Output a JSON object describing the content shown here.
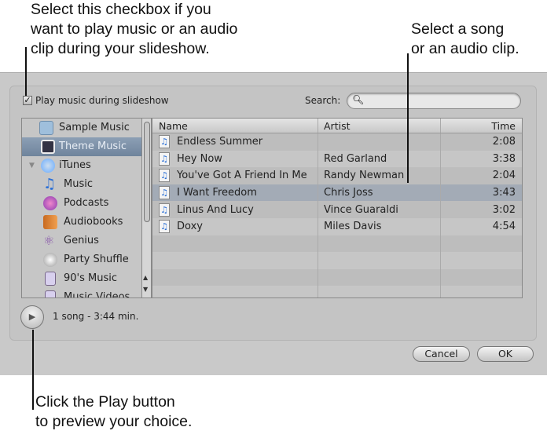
{
  "callouts": {
    "checkbox": [
      "Select this checkbox if you",
      "want to play music or an audio",
      "clip during your slideshow."
    ],
    "song": [
      "Select a song",
      "or an audio clip."
    ],
    "play": [
      "Click the Play button",
      "to preview your choice."
    ]
  },
  "options": {
    "play_music_label": "Play music during slideshow",
    "play_music_checked": true
  },
  "search": {
    "label": "Search:",
    "value": ""
  },
  "sources": [
    {
      "label": "Sample Music",
      "icon": "folder-icon"
    },
    {
      "label": "Theme Music",
      "icon": "theme-icon",
      "selected": true
    },
    {
      "label": "iTunes",
      "icon": "itunes-icon"
    },
    {
      "label": "Music",
      "icon": "music-note-icon"
    },
    {
      "label": "Podcasts",
      "icon": "podcast-icon"
    },
    {
      "label": "Audiobooks",
      "icon": "audiobook-icon"
    },
    {
      "label": "Genius",
      "icon": "genius-icon"
    },
    {
      "label": "Party Shuffle",
      "icon": "party-shuffle-icon"
    },
    {
      "label": "90's Music",
      "icon": "smart-playlist-icon"
    },
    {
      "label": "Music Videos",
      "icon": "playlist-icon"
    }
  ],
  "table": {
    "headers": [
      "Name",
      "Artist",
      "Time"
    ],
    "rows": [
      {
        "name": "Endless Summer",
        "artist": "",
        "time": "2:08"
      },
      {
        "name": "Hey Now",
        "artist": "Red Garland",
        "time": "3:38"
      },
      {
        "name": "You've Got A Friend In Me",
        "artist": "Randy Newman",
        "time": "2:04"
      },
      {
        "name": "I Want Freedom",
        "artist": "Chris Joss",
        "time": "3:43",
        "selected": true
      },
      {
        "name": "Linus And Lucy",
        "artist": "Vince Guaraldi",
        "time": "3:02"
      },
      {
        "name": "Doxy",
        "artist": "Miles Davis",
        "time": "4:54"
      }
    ]
  },
  "status": "1 song - 3:44 min.",
  "buttons": {
    "cancel": "Cancel",
    "ok": "OK"
  }
}
